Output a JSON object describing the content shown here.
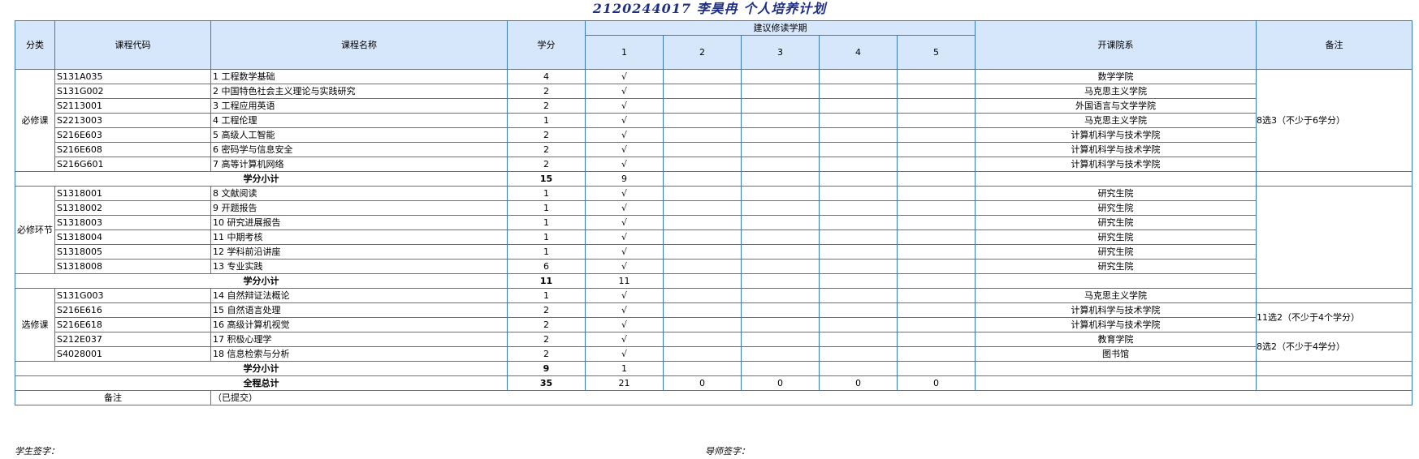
{
  "title": "2120244017 李昊冉 个人培养计划",
  "headers": {
    "category": "分类",
    "code": "课程代码",
    "name": "课程名称",
    "credit": "学分",
    "semester_group": "建议修读学期",
    "semesters": [
      "1",
      "2",
      "3",
      "4",
      "5"
    ],
    "college": "开课院系",
    "remark": "备注"
  },
  "check_mark": "√",
  "sections": [
    {
      "category": "必修课",
      "courses": [
        {
          "code": "S131A035",
          "name": "1  工程数学基础",
          "credit": "4",
          "sem1": "√",
          "college": "数学学院"
        },
        {
          "code": "S131G002",
          "name": "2  中国特色社会主义理论与实践研究",
          "credit": "2",
          "sem1": "√",
          "college": "马克思主义学院"
        },
        {
          "code": "S2113001",
          "name": "3  工程应用英语",
          "credit": "2",
          "sem1": "√",
          "college": "外国语言与文学学院"
        },
        {
          "code": "S2213003",
          "name": "4  工程伦理",
          "credit": "1",
          "sem1": "√",
          "college": "马克思主义学院"
        },
        {
          "code": "S216E603",
          "name": "5  高级人工智能",
          "credit": "2",
          "sem1": "√",
          "college": "计算机科学与技术学院"
        },
        {
          "code": "S216E608",
          "name": "6  密码学与信息安全",
          "credit": "2",
          "sem1": "√",
          "college": "计算机科学与技术学院"
        },
        {
          "code": "S216G601",
          "name": "7  高等计算机网络",
          "credit": "2",
          "sem1": "√",
          "college": "计算机科学与技术学院"
        }
      ],
      "remark_1": "8选3（不少于6学分）",
      "subtotal_label": "学分小计",
      "subtotal_credit": "15",
      "subtotal_sem1": "9"
    },
    {
      "category": "必修环节",
      "courses": [
        {
          "code": "S1318001",
          "name": "8  文献阅读",
          "credit": "1",
          "sem1": "√",
          "college": "研究生院"
        },
        {
          "code": "S1318002",
          "name": "9  开题报告",
          "credit": "1",
          "sem1": "√",
          "college": "研究生院"
        },
        {
          "code": "S1318003",
          "name": "10  研究进展报告",
          "credit": "1",
          "sem1": "√",
          "college": "研究生院"
        },
        {
          "code": "S1318004",
          "name": "11  中期考核",
          "credit": "1",
          "sem1": "√",
          "college": "研究生院"
        },
        {
          "code": "S1318005",
          "name": "12  学科前沿讲座",
          "credit": "1",
          "sem1": "√",
          "college": "研究生院"
        },
        {
          "code": "S1318008",
          "name": "13  专业实践",
          "credit": "6",
          "sem1": "√",
          "college": "研究生院"
        }
      ],
      "subtotal_label": "学分小计",
      "subtotal_credit": "11",
      "subtotal_sem1": "11"
    },
    {
      "category": "选修课",
      "courses": [
        {
          "code": "S131G003",
          "name": "14  自然辩证法概论",
          "credit": "1",
          "sem1": "√",
          "college": "马克思主义学院"
        },
        {
          "code": "S216E616",
          "name": "15  自然语言处理",
          "credit": "2",
          "sem1": "√",
          "college": "计算机科学与技术学院"
        },
        {
          "code": "S216E618",
          "name": "16  高级计算机视觉",
          "credit": "2",
          "sem1": "√",
          "college": "计算机科学与技术学院"
        },
        {
          "code": "S212E037",
          "name": "17  积极心理学",
          "credit": "2",
          "sem1": "√",
          "college": "教育学院"
        },
        {
          "code": "S4028001",
          "name": "18  信息检索与分析",
          "credit": "2",
          "sem1": "√",
          "college": "图书馆"
        }
      ],
      "remark_1": "11选2（不少于4个学分）",
      "remark_2": "8选2（不少于4学分）",
      "subtotal_label": "学分小计",
      "subtotal_credit": "9",
      "subtotal_sem1": "1"
    }
  ],
  "grand_total": {
    "label": "全程总计",
    "credit": "35",
    "sem": [
      "21",
      "0",
      "0",
      "0",
      "0"
    ]
  },
  "footer_row": {
    "label": "备注",
    "value": "（已提交）"
  },
  "signatures": {
    "student": "学生签字：",
    "advisor": "导师签字："
  }
}
